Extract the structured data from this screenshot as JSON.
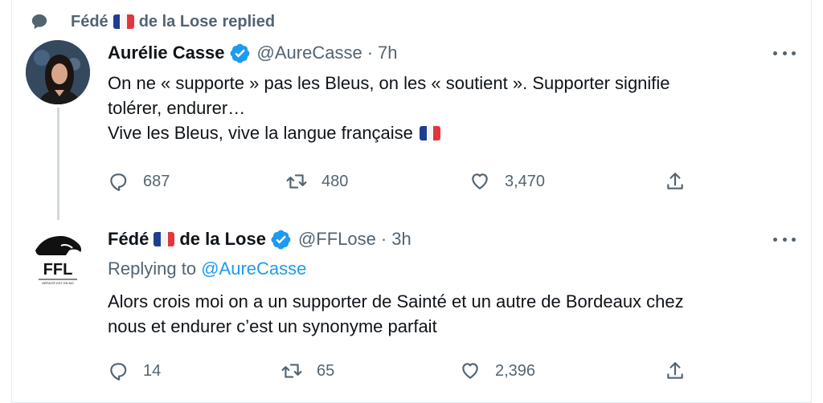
{
  "context": {
    "name_part1": "Fédé",
    "name_part2": "de la Lose",
    "action": "replied"
  },
  "tweets": [
    {
      "author": "Aurélie Casse",
      "handle": "@AureCasse",
      "time": "7h",
      "lines": [
        "On ne « supporte » pas les Bleus, on les « soutient ». Supporter signifie",
        "tolérer, endurer…",
        "Vive les Bleus, vive la langue française"
      ],
      "replies": "687",
      "retweets": "480",
      "likes": "3,470"
    },
    {
      "author_part1": "Fédé",
      "author_part2": "de la Lose",
      "handle": "@FFLose",
      "time": "3h",
      "replying_label": "Replying to",
      "replying_to": "@AureCasse",
      "lines": [
        "Alors crois moi on a un supporter de Sainté et un autre de Bordeaux chez",
        "nous et endurer c’est un synonyme parfait"
      ],
      "replies": "14",
      "retweets": "65",
      "likes": "2,396"
    }
  ],
  "logo": {
    "text": "FFL",
    "motto": "DÉFAITE EST EN NO"
  },
  "icons": {
    "reply": "reply-icon",
    "retweet": "retweet-icon",
    "like": "heart-icon",
    "share": "share-icon",
    "verified": "verified-badge-icon",
    "more": "more-icon",
    "context": "speech-bubble-icon",
    "flag": "french-flag-icon"
  },
  "colors": {
    "text": "#0f1419",
    "secondary": "#536471",
    "accent": "#1d9bf0",
    "thread_line": "#cfd9de"
  }
}
